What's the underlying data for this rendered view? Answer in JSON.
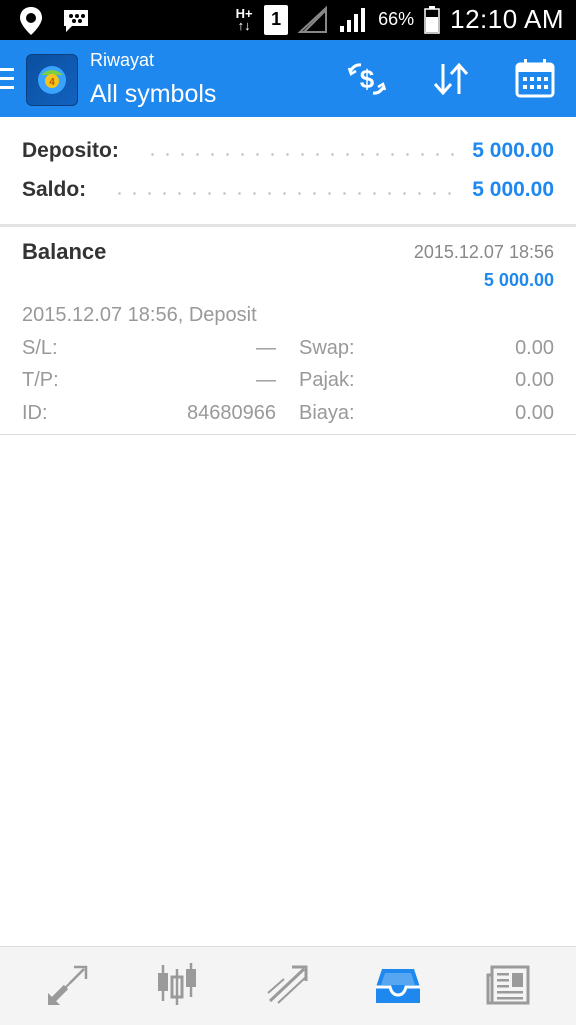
{
  "status_bar": {
    "net_top": "H+",
    "net_bottom": "↑↓",
    "sim_slot": "1",
    "battery": "66%",
    "time": "12:10 AM",
    "icons": [
      "location-icon",
      "bbm-icon",
      "network-type-icon",
      "sim-icon",
      "no-signal-icon",
      "signal-icon",
      "battery-icon"
    ]
  },
  "app_bar": {
    "subtitle": "Riwayat",
    "title": "All symbols",
    "icons": [
      "menu-icon",
      "metatrader-logo",
      "exchange-icon",
      "sort-icon",
      "calendar-icon"
    ],
    "accent_color": "#1e88ee"
  },
  "summary": {
    "deposit_label": "Deposito:",
    "deposit_value": "5 000.00",
    "balance_label": "Saldo:",
    "balance_value": "5 000.00"
  },
  "entry": {
    "title": "Balance",
    "time": "2015.12.07 18:56",
    "amount": "5 000.00",
    "description": "2015.12.07 18:56, Deposit",
    "sl_label": "S/L:",
    "sl_value": "—",
    "tp_label": "T/P:",
    "tp_value": "—",
    "id_label": "ID:",
    "id_value": "84680966",
    "swap_label": "Swap:",
    "swap_value": "0.00",
    "tax_label": "Pajak:",
    "tax_value": "0.00",
    "fee_label": "Biaya:",
    "fee_value": "0.00"
  },
  "bottom_nav": {
    "items": [
      "quotes-icon",
      "chart-icon",
      "trade-icon",
      "history-icon",
      "news-icon"
    ],
    "active": "history-icon"
  }
}
